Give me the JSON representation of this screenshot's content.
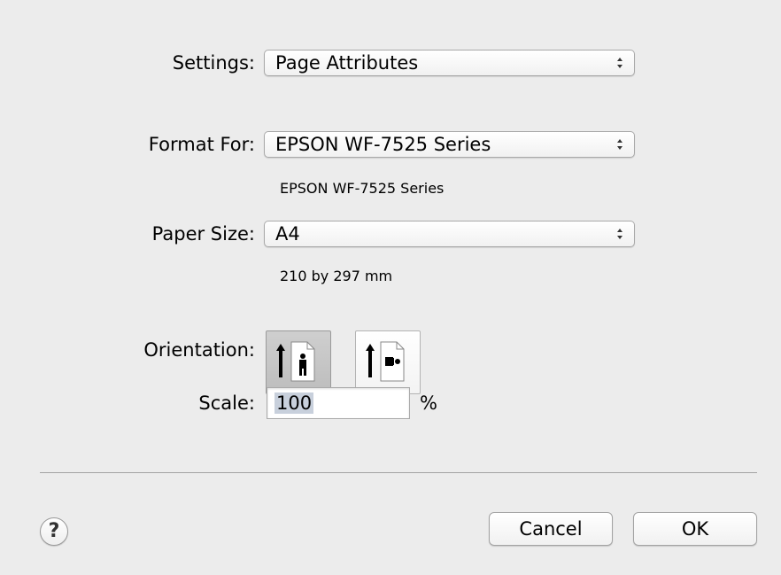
{
  "settings": {
    "label": "Settings:",
    "value": "Page Attributes"
  },
  "format_for": {
    "label": "Format For:",
    "value": "EPSON WF-7525 Series",
    "description": "EPSON WF-7525 Series"
  },
  "paper_size": {
    "label": "Paper Size:",
    "value": "A4",
    "dimensions": "210 by 297 mm"
  },
  "orientation": {
    "label": "Orientation:",
    "options": [
      {
        "icon": "portrait-orientation-icon",
        "selected": true
      },
      {
        "icon": "landscape-orientation-icon",
        "selected": false
      }
    ]
  },
  "scale": {
    "label": "Scale:",
    "value": "100",
    "unit": "%"
  },
  "buttons": {
    "help": "?",
    "cancel": "Cancel",
    "ok": "OK"
  }
}
